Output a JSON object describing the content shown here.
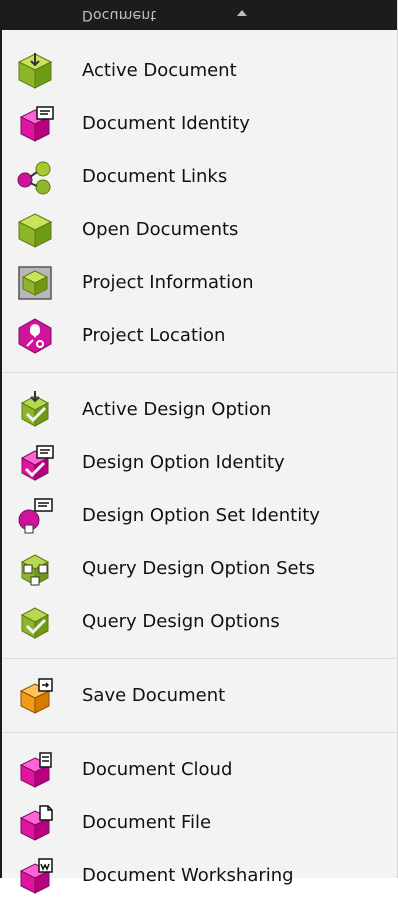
{
  "header": {
    "title": "Document"
  },
  "groups": [
    {
      "items": [
        {
          "label": "Active Document",
          "icon": "active-document-icon"
        },
        {
          "label": "Document Identity",
          "icon": "document-identity-icon"
        },
        {
          "label": "Document Links",
          "icon": "document-links-icon"
        },
        {
          "label": "Open Documents",
          "icon": "open-documents-icon"
        },
        {
          "label": "Project Information",
          "icon": "project-information-icon"
        },
        {
          "label": "Project Location",
          "icon": "project-location-icon"
        }
      ]
    },
    {
      "items": [
        {
          "label": "Active Design Option",
          "icon": "active-design-option-icon"
        },
        {
          "label": "Design Option Identity",
          "icon": "design-option-identity-icon"
        },
        {
          "label": "Design Option Set Identity",
          "icon": "design-option-set-identity-icon"
        },
        {
          "label": "Query Design Option Sets",
          "icon": "query-design-option-sets-icon"
        },
        {
          "label": "Query Design Options",
          "icon": "query-design-options-icon"
        }
      ]
    },
    {
      "items": [
        {
          "label": "Save Document",
          "icon": "save-document-icon"
        }
      ]
    },
    {
      "items": [
        {
          "label": "Document Cloud",
          "icon": "document-cloud-icon"
        },
        {
          "label": "Document File",
          "icon": "document-file-icon"
        },
        {
          "label": "Document Worksharing",
          "icon": "document-worksharing-icon"
        }
      ]
    }
  ]
}
